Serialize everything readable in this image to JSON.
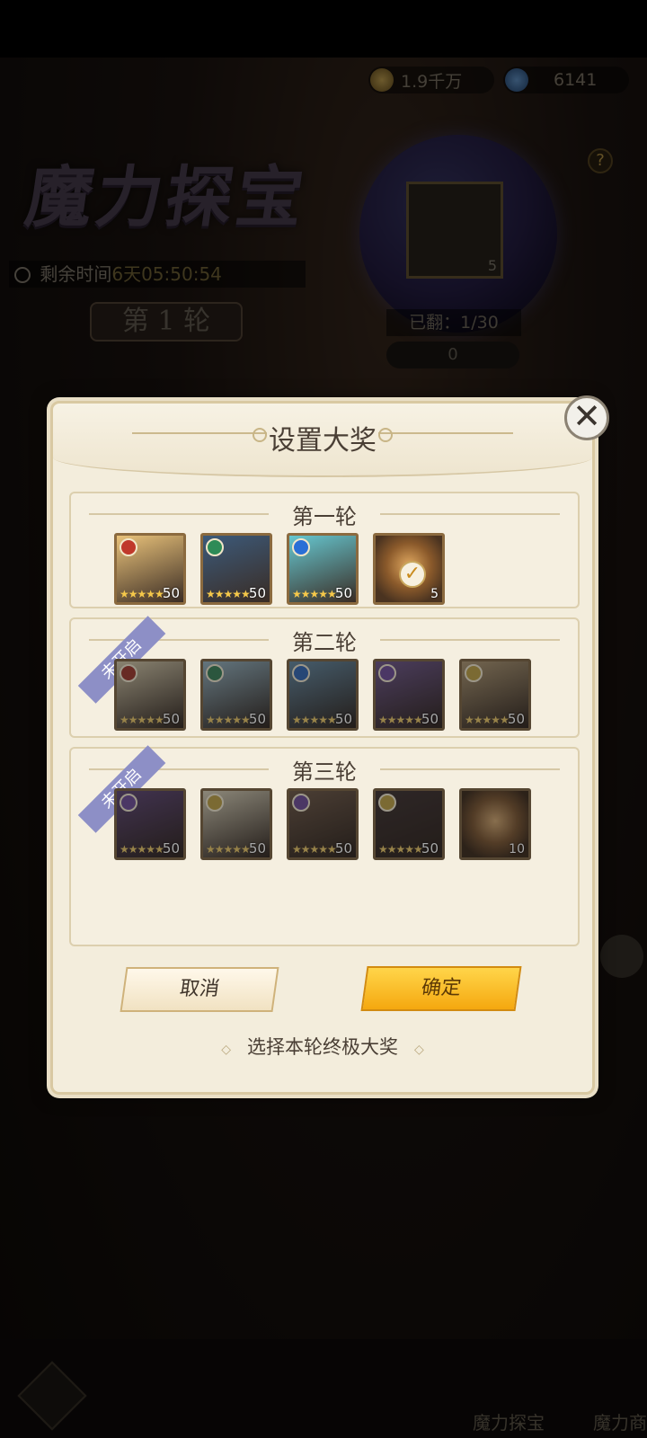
{
  "resources": {
    "gold": "1.9千万",
    "gems": "6141"
  },
  "event": {
    "logo_text": "魔力探宝",
    "timer_label": "剩余时间",
    "timer_value": "6天05:50:54",
    "round_banner": "第 1 轮",
    "flipped": "已翻：1/30",
    "keys": "0",
    "orb_item_count": "5"
  },
  "modal": {
    "title": "设置大奖",
    "rounds": [
      {
        "title": "第一轮",
        "locked": false
      },
      {
        "title": "第二轮",
        "locked": true,
        "locked_label": "未开启"
      },
      {
        "title": "第三轮",
        "locked": true,
        "locked_label": "未开启"
      }
    ],
    "cards": {
      "r1": [
        {
          "level": "50",
          "faction_color": "#c0392b",
          "art": "#e9c27a"
        },
        {
          "level": "50",
          "faction_color": "#2e8b57",
          "art": "#3c5a7a"
        },
        {
          "level": "50",
          "faction_color": "#2a6fd6",
          "art": "#66c7d0"
        },
        {
          "qty": "5",
          "selected": true
        }
      ],
      "r2": [
        {
          "level": "50",
          "faction_color": "#c0392b",
          "art": "#d7c8a0"
        },
        {
          "level": "50",
          "faction_color": "#2e8b57",
          "art": "#8fb6c9"
        },
        {
          "level": "50",
          "faction_color": "#2a6fd6",
          "art": "#5f8fb0"
        },
        {
          "level": "50",
          "faction_color": "#7b4fb5",
          "art": "#7a5aa0"
        },
        {
          "level": "50",
          "faction_color": "#c9a42a",
          "art": "#b89a6a"
        }
      ],
      "r3": [
        {
          "level": "50",
          "faction_color": "#7b4fb5",
          "art": "#6a4a8a"
        },
        {
          "level": "50",
          "faction_color": "#c9a42a",
          "art": "#d9cfb0"
        },
        {
          "level": "50",
          "faction_color": "#7b4fb5",
          "art": "#7a5e48"
        },
        {
          "level": "50",
          "faction_color": "#c9a42a",
          "art": "#4a3a3a"
        },
        {
          "qty": "10"
        }
      ]
    },
    "cancel_label": "取消",
    "confirm_label": "确定",
    "hint": "选择本轮终极大奖"
  },
  "nav": {
    "tab1": "魔力探宝",
    "tab2": "魔力商城"
  }
}
